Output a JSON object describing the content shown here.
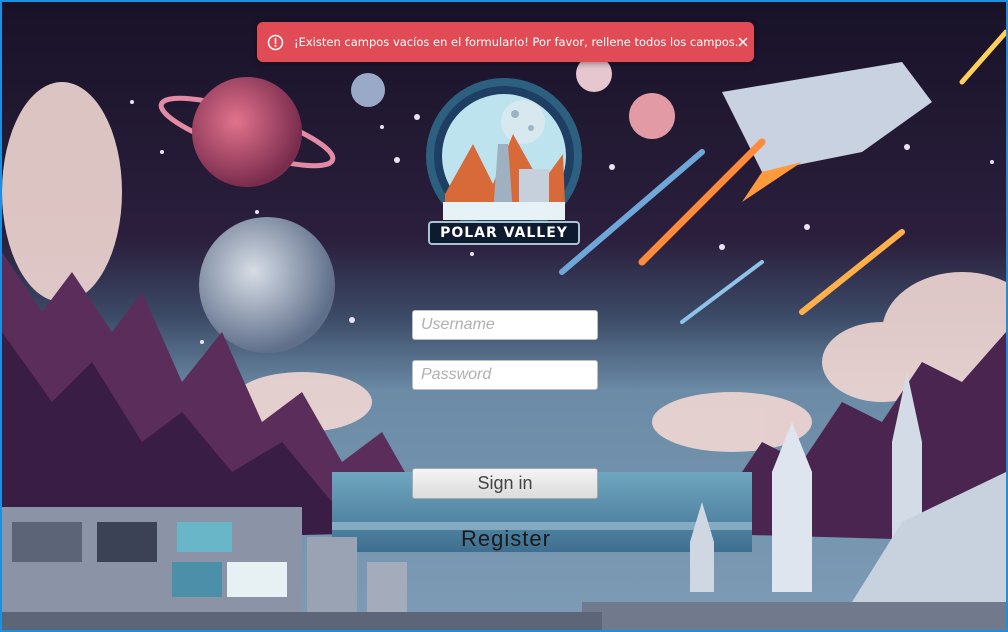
{
  "toast": {
    "message": "¡Existen campos vacíos en el formulario! Por favor, rellene todos los campos.",
    "icon": "alert-circle-icon",
    "close_icon": "close-icon",
    "color": "#e14b56"
  },
  "logo": {
    "text": "POLAR VALLEY"
  },
  "form": {
    "username_placeholder": "Username",
    "password_placeholder": "Password",
    "signin_label": "Sign in",
    "register_label": "Register"
  },
  "colors": {
    "frame_border": "#1e8fe0"
  }
}
